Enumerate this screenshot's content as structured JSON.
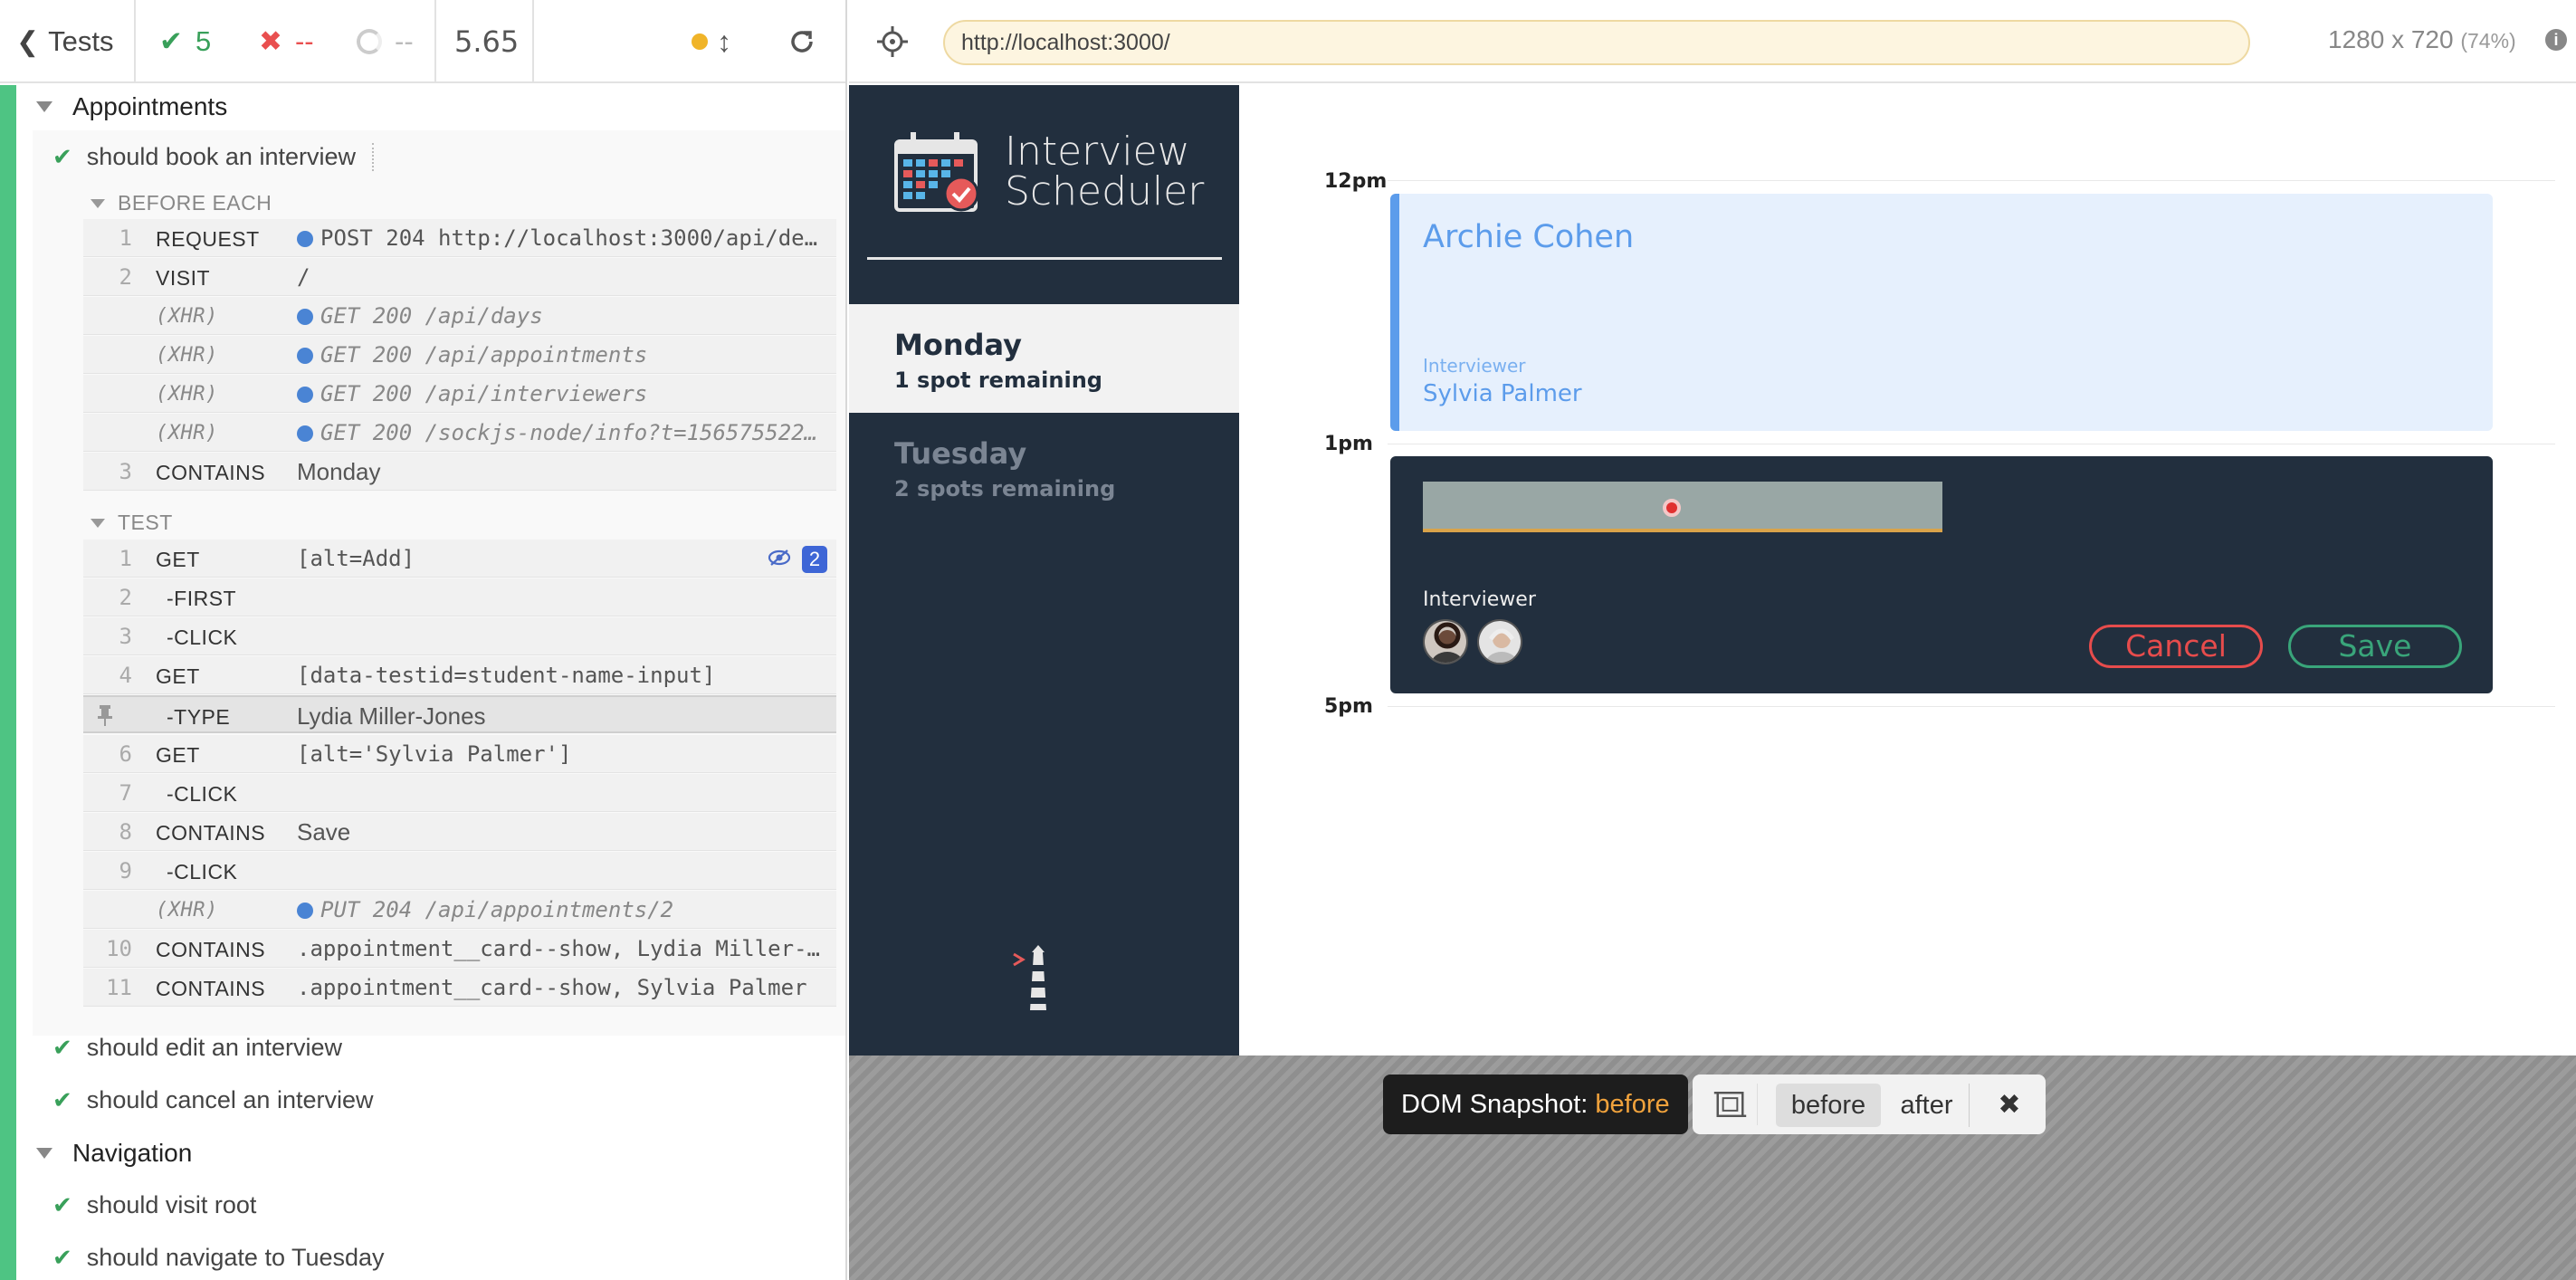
{
  "runner": {
    "tests_label": "Tests",
    "passed": "5",
    "failed": "--",
    "pending": "--",
    "duration": "5.65"
  },
  "reporter": {
    "suite1": "Appointments",
    "active_test": "should book an interview",
    "before_each": "BEFORE EACH",
    "test_hook": "TEST",
    "before_commands": [
      {
        "num": "1",
        "name": "REQUEST",
        "msg": "POST 204 http://localhost:3000/api/de…"
      },
      {
        "num": "2",
        "name": "VISIT",
        "msg": "/"
      },
      {
        "num": "",
        "name": "(XHR)",
        "msg": "GET 200 /api/days"
      },
      {
        "num": "",
        "name": "(XHR)",
        "msg": "GET 200 /api/appointments"
      },
      {
        "num": "",
        "name": "(XHR)",
        "msg": "GET 200 /api/interviewers"
      },
      {
        "num": "",
        "name": "(XHR)",
        "msg": "GET 200 /sockjs-node/info?t=156575522…"
      },
      {
        "num": "3",
        "name": "CONTAINS",
        "msg": "Monday"
      }
    ],
    "test_commands": [
      {
        "num": "1",
        "name": "GET",
        "msg": "[alt=Add]",
        "badge": "2"
      },
      {
        "num": "2",
        "name": "-FIRST",
        "msg": ""
      },
      {
        "num": "3",
        "name": "-CLICK",
        "msg": ""
      },
      {
        "num": "4",
        "name": "GET",
        "msg": "[data-testid=student-name-input]"
      },
      {
        "num": "",
        "name": "-TYPE",
        "msg": "Lydia Miller-Jones"
      },
      {
        "num": "6",
        "name": "GET",
        "msg": "[alt='Sylvia Palmer']"
      },
      {
        "num": "7",
        "name": "-CLICK",
        "msg": ""
      },
      {
        "num": "8",
        "name": "CONTAINS",
        "msg": "Save"
      },
      {
        "num": "9",
        "name": "-CLICK",
        "msg": ""
      },
      {
        "num": "",
        "name": "(XHR)",
        "msg": "PUT 204 /api/appointments/2"
      },
      {
        "num": "10",
        "name": "CONTAINS",
        "msg": ".appointment__card--show, Lydia Miller-…"
      },
      {
        "num": "11",
        "name": "CONTAINS",
        "msg": ".appointment__card--show, Sylvia Palmer"
      }
    ],
    "other_tests": [
      "should edit an interview",
      "should cancel an interview"
    ],
    "suite2": "Navigation",
    "nav_tests": [
      "should visit root",
      "should navigate to Tuesday"
    ]
  },
  "address": {
    "url": "http://localhost:3000/",
    "viewport": "1280 x 720",
    "zoom": "(74%)",
    "info": "i"
  },
  "app": {
    "logo_line1": "Interview",
    "logo_line2": "Scheduler",
    "days": [
      {
        "name": "Monday",
        "spots": "1 spot remaining"
      },
      {
        "name": "Tuesday",
        "spots": "2 spots remaining"
      }
    ],
    "times": [
      "12pm",
      "1pm",
      "5pm"
    ],
    "show_card": {
      "student": "Archie Cohen",
      "interviewer_label": "Interviewer",
      "interviewer": "Sylvia Palmer"
    },
    "form": {
      "interviewer_label": "Interviewer",
      "cancel": "Cancel",
      "save": "Save"
    }
  },
  "snapshot": {
    "label": "DOM Snapshot:",
    "state": "before",
    "before": "before",
    "after": "after",
    "close": "✖"
  },
  "colors": {
    "pass": "#39a05a",
    "fail": "#e94f4f",
    "sidebar": "#222f3e",
    "show_accent": "#5c9ceb",
    "snapshot_state": "#f0a23c"
  }
}
